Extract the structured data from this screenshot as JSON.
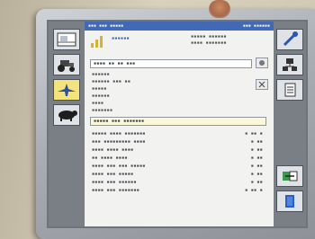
{
  "titlebar": {
    "left": "▪▪▪ ▪▪▪ ▪▪▪▪▪",
    "right": "▪▪▪ ▪▪▪▪▪▪"
  },
  "header": {
    "product_label": "▪▪▪▪▪▪",
    "info_line1": "▪▪▪▪▪ ▪▪▪▪▪▪",
    "info_line2": "▪▪▪▪ ▪▪▪▪▪▪▪"
  },
  "form": {
    "field1": "▪▪▪▪ ▪▪ ▪▪ ▪▪▪",
    "line1": "▪▪▪▪▪▪",
    "line2": "▪▪▪▪▪▪  ▪▪▪ ▪▪",
    "line3": "▪▪▪▪▪",
    "line4": "▪▪▪▪▪▪",
    "line5": "▪▪▪▪",
    "line6": "▪▪▪▪▪▪▪",
    "field2": "▪▪▪▪▪ ▪▪▪ ▪▪▪▪▪▪▪"
  },
  "summary": {
    "rows": [
      {
        "label": "▪▪▪▪▪   ▪▪▪▪ ▪▪▪▪▪▪▪",
        "value": "▪ ▪▪ ▪"
      },
      {
        "label": "▪▪▪ ▪▪▪▪▪▪▪▪▪ ▪▪▪▪",
        "value": "▪ ▪▪"
      },
      {
        "label": "▪▪▪▪ ▪▪▪▪ ▪▪▪▪",
        "value": "▪ ▪▪"
      },
      {
        "label": "▪▪ ▪▪▪▪ ▪▪▪▪",
        "value": "▪ ▪▪"
      },
      {
        "label": "▪▪▪▪ ▪▪▪ ▪▪▪ ▪▪▪▪▪",
        "value": "▪ ▪▪"
      },
      {
        "label": "▪▪▪▪ ▪▪▪ ▪▪▪▪▪",
        "value": "▪ ▪▪"
      },
      {
        "label": "▪▪▪▪ ▪▪▪  ▪▪▪▪▪▪",
        "value": "▪ ▪▪"
      },
      {
        "label": "▪▪▪▪ ▪▪▪ ▪▪▪▪▪▪▪",
        "value": "▪ ▪▪ ▪"
      }
    ]
  },
  "icons": {
    "left": [
      "field-map-icon",
      "tractor-icon",
      "plane-icon",
      "livestock-icon"
    ],
    "right": [
      "wrench-icon",
      "network-icon",
      "document-icon",
      "transfer-icon",
      "book-icon"
    ],
    "form_buttons": [
      "record-icon",
      "close-icon"
    ]
  },
  "colors": {
    "titlebar": "#4169b5",
    "active_tool": "#f3e37d",
    "toolbar_bg": "#7a7f86"
  }
}
